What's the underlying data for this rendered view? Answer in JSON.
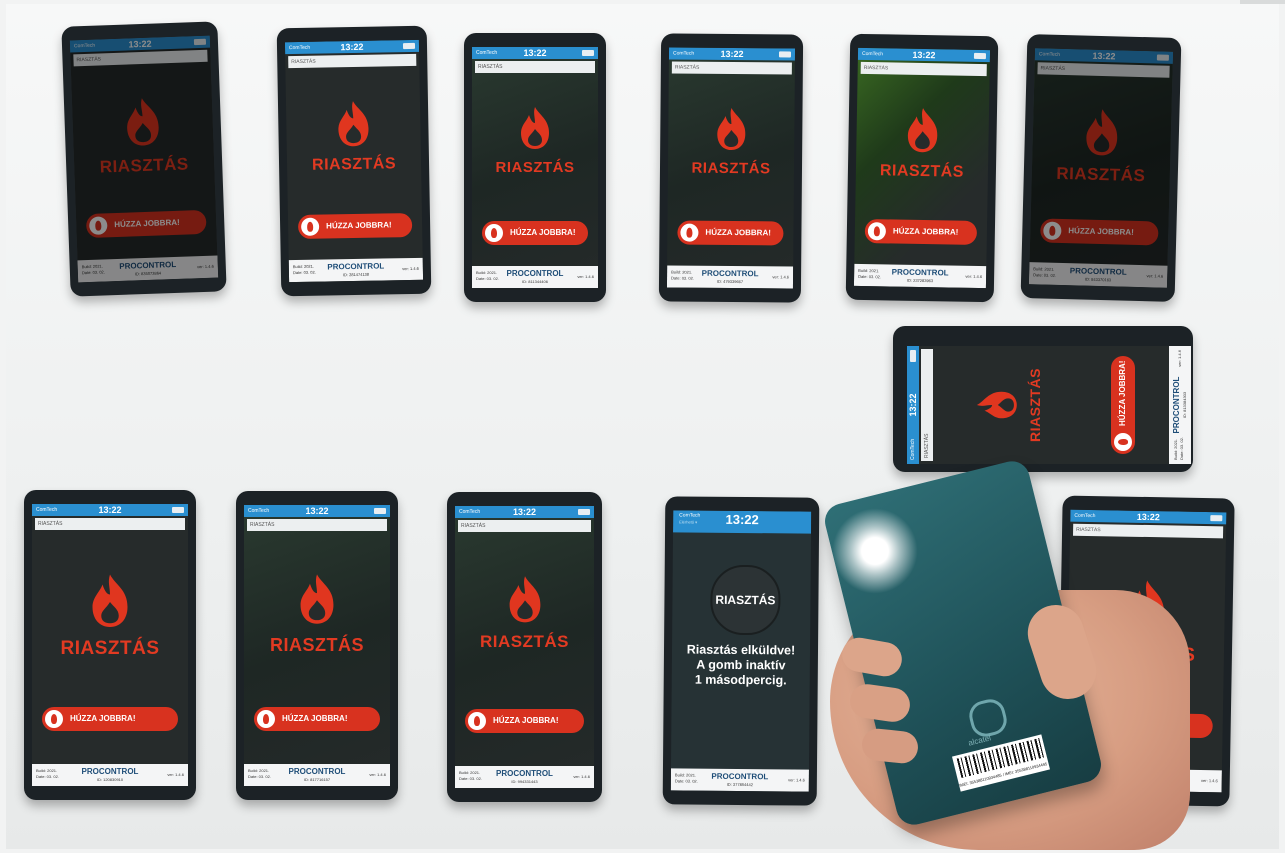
{
  "alert_label": "RIASZTÁS",
  "slider_label": "HÚZZA JOBBRA!",
  "clock": "13:22",
  "footer": {
    "brand": "PROCONTROL",
    "build_line1": "Build: 2021.",
    "build_line2": "Date: 03. 02.",
    "version": "ver: 1.4.6"
  },
  "phones": [
    {
      "id_field": "RIASZTÁS",
      "device_id": "ID: 835073864"
    },
    {
      "id_field": "RIASZTÁS",
      "device_id": "ID: 281474138"
    },
    {
      "id_field": "RIASZTÁS",
      "device_id": "ID: 811344406"
    },
    {
      "id_field": "RIASZTÁS",
      "device_id": "ID: 479339667"
    },
    {
      "id_field": "RIASZTÁS",
      "device_id": "ID: 237283963"
    },
    {
      "id_field": "RIASZTÁS",
      "device_id": "ID: 843370163"
    },
    {
      "id_field": "RIASZTÁS",
      "device_id": "ID: 813384303"
    },
    {
      "id_field": "RIASZTÁS",
      "device_id": "ID: 120830910"
    },
    {
      "id_field": "RIASZTÁS",
      "device_id": "ID: 817716157"
    },
    {
      "id_field": "RIASZTÁS",
      "device_id": "ID: 994331443"
    },
    {
      "id_field": "RIASZTÁS",
      "device_id": "ID: 377854442"
    }
  ],
  "sent_phone": {
    "brand": "ComTech",
    "sub": "Elérhető ▾",
    "button": "RIASZTÁS",
    "message": [
      "Riasztás elküldve!",
      "A gomb inaktív",
      "1 másodpercig."
    ],
    "device_id": "ID: 377854442"
  },
  "held_phone": {
    "brand": "alcatel",
    "barcode_text": "IMEI: 355388110934485 / IMEI: 355388110934495"
  }
}
